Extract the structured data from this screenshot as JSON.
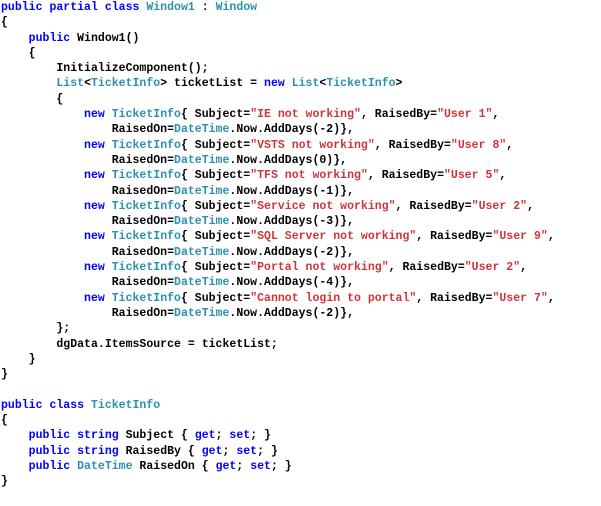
{
  "editor": {
    "language": "C#",
    "colors": {
      "keyword": "#0000FF",
      "type": "#2B91AF",
      "string": "#D13438",
      "plain": "#000000",
      "background": "#FFFFFF"
    }
  },
  "code": {
    "lines": [
      [
        {
          "t": "keyword",
          "v": "public partial class "
        },
        {
          "t": "type",
          "v": "Window1"
        },
        {
          "t": "plain",
          "v": " : "
        },
        {
          "t": "type",
          "v": "Window"
        }
      ],
      [
        {
          "t": "plain",
          "v": "{"
        }
      ],
      [
        {
          "t": "keyword",
          "v": "    public "
        },
        {
          "t": "plain",
          "v": "Window1()"
        }
      ],
      [
        {
          "t": "plain",
          "v": "    {"
        }
      ],
      [
        {
          "t": "plain",
          "v": "        InitializeComponent();"
        }
      ],
      [
        {
          "t": "type",
          "v": "        List"
        },
        {
          "t": "plain",
          "v": "<"
        },
        {
          "t": "type",
          "v": "TicketInfo"
        },
        {
          "t": "plain",
          "v": "> ticketList = "
        },
        {
          "t": "keyword",
          "v": "new "
        },
        {
          "t": "type",
          "v": "List"
        },
        {
          "t": "plain",
          "v": "<"
        },
        {
          "t": "type",
          "v": "TicketInfo"
        },
        {
          "t": "plain",
          "v": ">"
        }
      ],
      [
        {
          "t": "plain",
          "v": "        {"
        }
      ],
      [
        {
          "t": "keyword",
          "v": "            new "
        },
        {
          "t": "type",
          "v": "TicketInfo"
        },
        {
          "t": "plain",
          "v": "{ Subject="
        },
        {
          "t": "string",
          "v": "\"IE not working\""
        },
        {
          "t": "plain",
          "v": ", RaisedBy="
        },
        {
          "t": "string",
          "v": "\"User 1\""
        },
        {
          "t": "plain",
          "v": ","
        }
      ],
      [
        {
          "t": "plain",
          "v": "                RaisedOn="
        },
        {
          "t": "type",
          "v": "DateTime"
        },
        {
          "t": "plain",
          "v": ".Now.AddDays(-2)},"
        }
      ],
      [
        {
          "t": "keyword",
          "v": "            new "
        },
        {
          "t": "type",
          "v": "TicketInfo"
        },
        {
          "t": "plain",
          "v": "{ Subject="
        },
        {
          "t": "string",
          "v": "\"VSTS not working\""
        },
        {
          "t": "plain",
          "v": ", RaisedBy="
        },
        {
          "t": "string",
          "v": "\"User 8\""
        },
        {
          "t": "plain",
          "v": ","
        }
      ],
      [
        {
          "t": "plain",
          "v": "                RaisedOn="
        },
        {
          "t": "type",
          "v": "DateTime"
        },
        {
          "t": "plain",
          "v": ".Now.AddDays(0)},"
        }
      ],
      [
        {
          "t": "keyword",
          "v": "            new "
        },
        {
          "t": "type",
          "v": "TicketInfo"
        },
        {
          "t": "plain",
          "v": "{ Subject="
        },
        {
          "t": "string",
          "v": "\"TFS not working\""
        },
        {
          "t": "plain",
          "v": ", RaisedBy="
        },
        {
          "t": "string",
          "v": "\"User 5\""
        },
        {
          "t": "plain",
          "v": ","
        }
      ],
      [
        {
          "t": "plain",
          "v": "                RaisedOn="
        },
        {
          "t": "type",
          "v": "DateTime"
        },
        {
          "t": "plain",
          "v": ".Now.AddDays(-1)},"
        }
      ],
      [
        {
          "t": "keyword",
          "v": "            new "
        },
        {
          "t": "type",
          "v": "TicketInfo"
        },
        {
          "t": "plain",
          "v": "{ Subject="
        },
        {
          "t": "string",
          "v": "\"Service not working\""
        },
        {
          "t": "plain",
          "v": ", RaisedBy="
        },
        {
          "t": "string",
          "v": "\"User 2\""
        },
        {
          "t": "plain",
          "v": ","
        }
      ],
      [
        {
          "t": "plain",
          "v": "                RaisedOn="
        },
        {
          "t": "type",
          "v": "DateTime"
        },
        {
          "t": "plain",
          "v": ".Now.AddDays(-3)},"
        }
      ],
      [
        {
          "t": "keyword",
          "v": "            new "
        },
        {
          "t": "type",
          "v": "TicketInfo"
        },
        {
          "t": "plain",
          "v": "{ Subject="
        },
        {
          "t": "string",
          "v": "\"SQL Server not working\""
        },
        {
          "t": "plain",
          "v": ", RaisedBy="
        },
        {
          "t": "string",
          "v": "\"User 9\""
        },
        {
          "t": "plain",
          "v": ","
        }
      ],
      [
        {
          "t": "plain",
          "v": "                RaisedOn="
        },
        {
          "t": "type",
          "v": "DateTime"
        },
        {
          "t": "plain",
          "v": ".Now.AddDays(-2)},"
        }
      ],
      [
        {
          "t": "keyword",
          "v": "            new "
        },
        {
          "t": "type",
          "v": "TicketInfo"
        },
        {
          "t": "plain",
          "v": "{ Subject="
        },
        {
          "t": "string",
          "v": "\"Portal not working\""
        },
        {
          "t": "plain",
          "v": ", RaisedBy="
        },
        {
          "t": "string",
          "v": "\"User 2\""
        },
        {
          "t": "plain",
          "v": ","
        }
      ],
      [
        {
          "t": "plain",
          "v": "                RaisedOn="
        },
        {
          "t": "type",
          "v": "DateTime"
        },
        {
          "t": "plain",
          "v": ".Now.AddDays(-4)},"
        }
      ],
      [
        {
          "t": "keyword",
          "v": "            new "
        },
        {
          "t": "type",
          "v": "TicketInfo"
        },
        {
          "t": "plain",
          "v": "{ Subject="
        },
        {
          "t": "string",
          "v": "\"Cannot login to portal\""
        },
        {
          "t": "plain",
          "v": ", RaisedBy="
        },
        {
          "t": "string",
          "v": "\"User 7\""
        },
        {
          "t": "plain",
          "v": ","
        }
      ],
      [
        {
          "t": "plain",
          "v": "                RaisedOn="
        },
        {
          "t": "type",
          "v": "DateTime"
        },
        {
          "t": "plain",
          "v": ".Now.AddDays(-2)},"
        }
      ],
      [
        {
          "t": "plain",
          "v": "        };"
        }
      ],
      [
        {
          "t": "plain",
          "v": "        dgData.ItemsSource = ticketList;"
        }
      ],
      [
        {
          "t": "plain",
          "v": "    }"
        }
      ],
      [
        {
          "t": "plain",
          "v": "}"
        }
      ],
      [],
      [
        {
          "t": "keyword",
          "v": "public class "
        },
        {
          "t": "type",
          "v": "TicketInfo"
        }
      ],
      [
        {
          "t": "plain",
          "v": "{"
        }
      ],
      [
        {
          "t": "keyword",
          "v": "    public string "
        },
        {
          "t": "plain",
          "v": "Subject { "
        },
        {
          "t": "keyword",
          "v": "get"
        },
        {
          "t": "plain",
          "v": "; "
        },
        {
          "t": "keyword",
          "v": "set"
        },
        {
          "t": "plain",
          "v": "; }"
        }
      ],
      [
        {
          "t": "keyword",
          "v": "    public string "
        },
        {
          "t": "plain",
          "v": "RaisedBy { "
        },
        {
          "t": "keyword",
          "v": "get"
        },
        {
          "t": "plain",
          "v": "; "
        },
        {
          "t": "keyword",
          "v": "set"
        },
        {
          "t": "plain",
          "v": "; }"
        }
      ],
      [
        {
          "t": "keyword",
          "v": "    public "
        },
        {
          "t": "type",
          "v": "DateTime"
        },
        {
          "t": "plain",
          "v": " RaisedOn { "
        },
        {
          "t": "keyword",
          "v": "get"
        },
        {
          "t": "plain",
          "v": "; "
        },
        {
          "t": "keyword",
          "v": "set"
        },
        {
          "t": "plain",
          "v": "; }"
        }
      ],
      [
        {
          "t": "plain",
          "v": "}"
        }
      ]
    ]
  }
}
